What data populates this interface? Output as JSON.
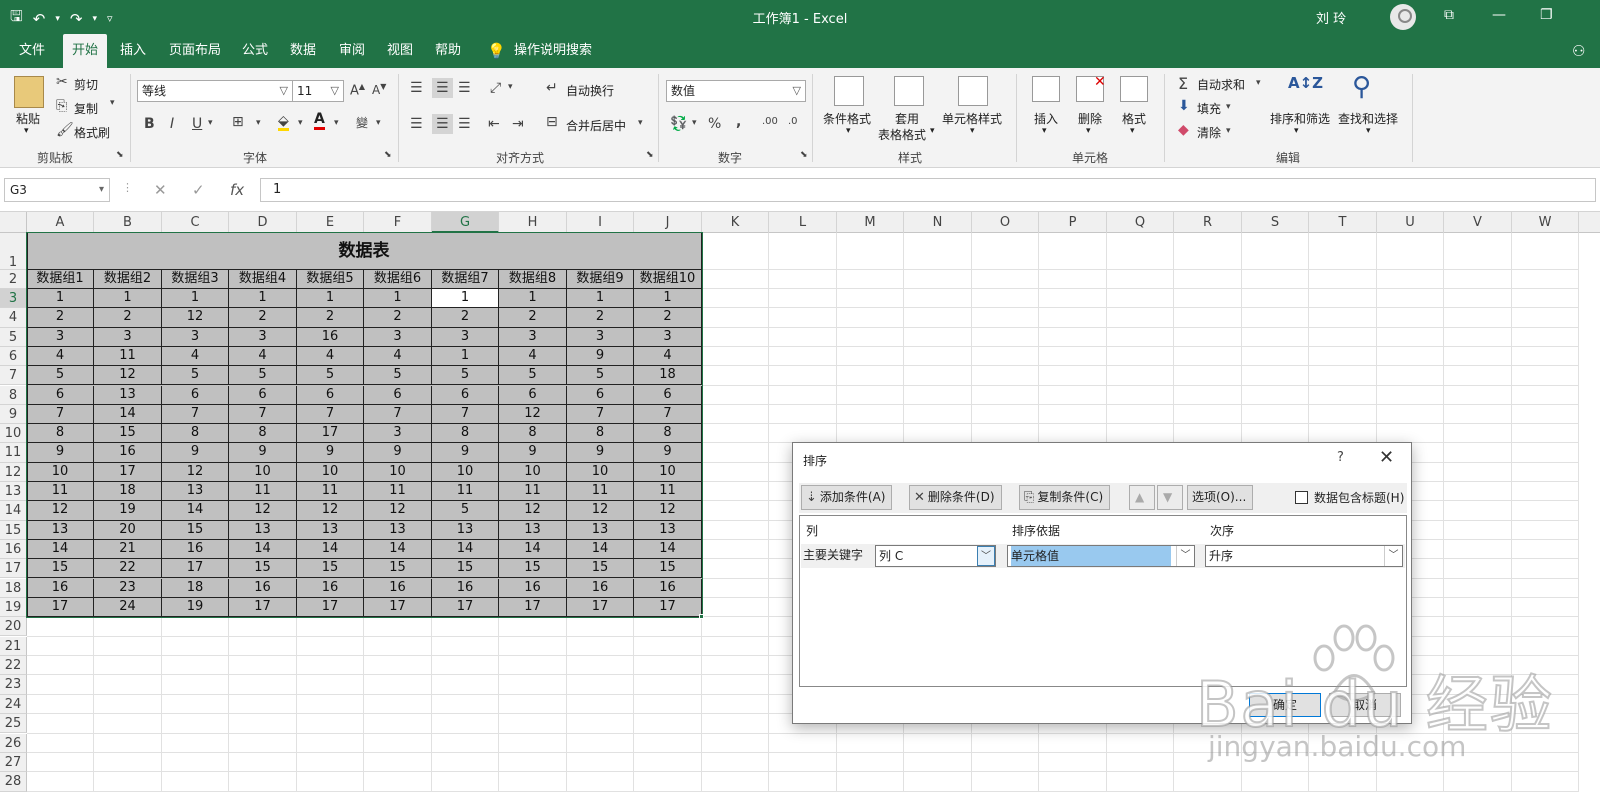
{
  "titlebar": {
    "title": "工作簿1  -  Excel",
    "user": "刘 玲"
  },
  "tabs": [
    "文件",
    "开始",
    "插入",
    "页面布局",
    "公式",
    "数据",
    "审阅",
    "视图",
    "帮助",
    "操作说明搜索"
  ],
  "active_tab": "开始",
  "ribbon": {
    "clipboard": {
      "paste": "粘贴",
      "cut": "剪切",
      "copy": "复制",
      "format_painter": "格式刷",
      "label": "剪贴板"
    },
    "font": {
      "name": "等线",
      "size": "11",
      "label": "字体"
    },
    "alignment": {
      "wrap": "自动换行",
      "merge": "合并后居中",
      "label": "对齐方式"
    },
    "number": {
      "format": "数值",
      "label": "数字"
    },
    "styles": {
      "cond_format": "条件格式",
      "table_format_1": "套用",
      "table_format_2": "表格格式",
      "cell_styles": "单元格样式",
      "label": "样式"
    },
    "cells": {
      "insert": "插入",
      "delete": "删除",
      "format": "格式",
      "label": "单元格"
    },
    "editing": {
      "autosum": "自动求和",
      "fill": "填充",
      "clear": "清除",
      "sort_filter": "排序和筛选",
      "find_select": "查找和选择",
      "label": "编辑"
    }
  },
  "formula_bar": {
    "name_box": "G3",
    "value": "1"
  },
  "grid": {
    "columns": [
      "A",
      "B",
      "C",
      "D",
      "E",
      "F",
      "G",
      "H",
      "I",
      "J",
      "K",
      "L",
      "M",
      "N",
      "O",
      "P",
      "Q",
      "R",
      "S",
      "T",
      "U",
      "V",
      "W"
    ],
    "rows": [
      "1",
      "2",
      "3",
      "4",
      "5",
      "6",
      "7",
      "8",
      "9",
      "10",
      "11",
      "12",
      "13",
      "14",
      "15",
      "16",
      "17",
      "18",
      "19",
      "20",
      "21",
      "22",
      "23",
      "24",
      "25",
      "26",
      "27",
      "28"
    ],
    "selected_column": "G",
    "selected_row": "3"
  },
  "table": {
    "title": "数据表",
    "headers": [
      "数据组1",
      "数据组2",
      "数据组3",
      "数据组4",
      "数据组5",
      "数据组6",
      "数据组7",
      "数据组8",
      "数据组9",
      "数据组10"
    ],
    "rows": [
      [
        "1",
        "1",
        "1",
        "1",
        "1",
        "1",
        "1",
        "1",
        "1",
        "1"
      ],
      [
        "2",
        "2",
        "12",
        "2",
        "2",
        "2",
        "2",
        "2",
        "2",
        "2"
      ],
      [
        "3",
        "3",
        "3",
        "3",
        "16",
        "3",
        "3",
        "3",
        "3",
        "3"
      ],
      [
        "4",
        "11",
        "4",
        "4",
        "4",
        "4",
        "1",
        "4",
        "9",
        "4"
      ],
      [
        "5",
        "12",
        "5",
        "5",
        "5",
        "5",
        "5",
        "5",
        "5",
        "18"
      ],
      [
        "6",
        "13",
        "6",
        "6",
        "6",
        "6",
        "6",
        "6",
        "6",
        "6"
      ],
      [
        "7",
        "14",
        "7",
        "7",
        "7",
        "7",
        "7",
        "12",
        "7",
        "7"
      ],
      [
        "8",
        "15",
        "8",
        "8",
        "17",
        "3",
        "8",
        "8",
        "8",
        "8"
      ],
      [
        "9",
        "16",
        "9",
        "9",
        "9",
        "9",
        "9",
        "9",
        "9",
        "9"
      ],
      [
        "10",
        "17",
        "12",
        "10",
        "10",
        "10",
        "10",
        "10",
        "10",
        "10"
      ],
      [
        "11",
        "18",
        "13",
        "11",
        "11",
        "11",
        "11",
        "11",
        "11",
        "11"
      ],
      [
        "12",
        "19",
        "14",
        "12",
        "12",
        "12",
        "5",
        "12",
        "12",
        "12"
      ],
      [
        "13",
        "20",
        "15",
        "13",
        "13",
        "13",
        "13",
        "13",
        "13",
        "13"
      ],
      [
        "14",
        "21",
        "16",
        "14",
        "14",
        "14",
        "14",
        "14",
        "14",
        "14"
      ],
      [
        "15",
        "22",
        "17",
        "15",
        "15",
        "15",
        "15",
        "15",
        "15",
        "15"
      ],
      [
        "16",
        "23",
        "18",
        "16",
        "16",
        "16",
        "16",
        "16",
        "16",
        "16"
      ],
      [
        "17",
        "24",
        "19",
        "17",
        "17",
        "17",
        "17",
        "17",
        "17",
        "17"
      ]
    ]
  },
  "dialog": {
    "title": "排序",
    "help": "?",
    "add_level": "添加条件(A)",
    "delete_level": "删除条件(D)",
    "copy_level": "复制条件(C)",
    "options": "选项(O)...",
    "has_headers": "数据包含标题(H)",
    "col_header": "列",
    "sort_on_header": "排序依据",
    "order_header": "次序",
    "row_label": "主要关键字",
    "column_value": "列 C",
    "sort_on_value": "单元格值",
    "order_value": "升序",
    "ok": "确定",
    "cancel": "取消"
  },
  "watermark": {
    "text": "Bai du 经验",
    "url": "jingyan.baidu.com"
  },
  "colors": {
    "accent": "#217346",
    "table_fill": "#c0c0c0",
    "dialog_highlight": "#99c9ef"
  }
}
